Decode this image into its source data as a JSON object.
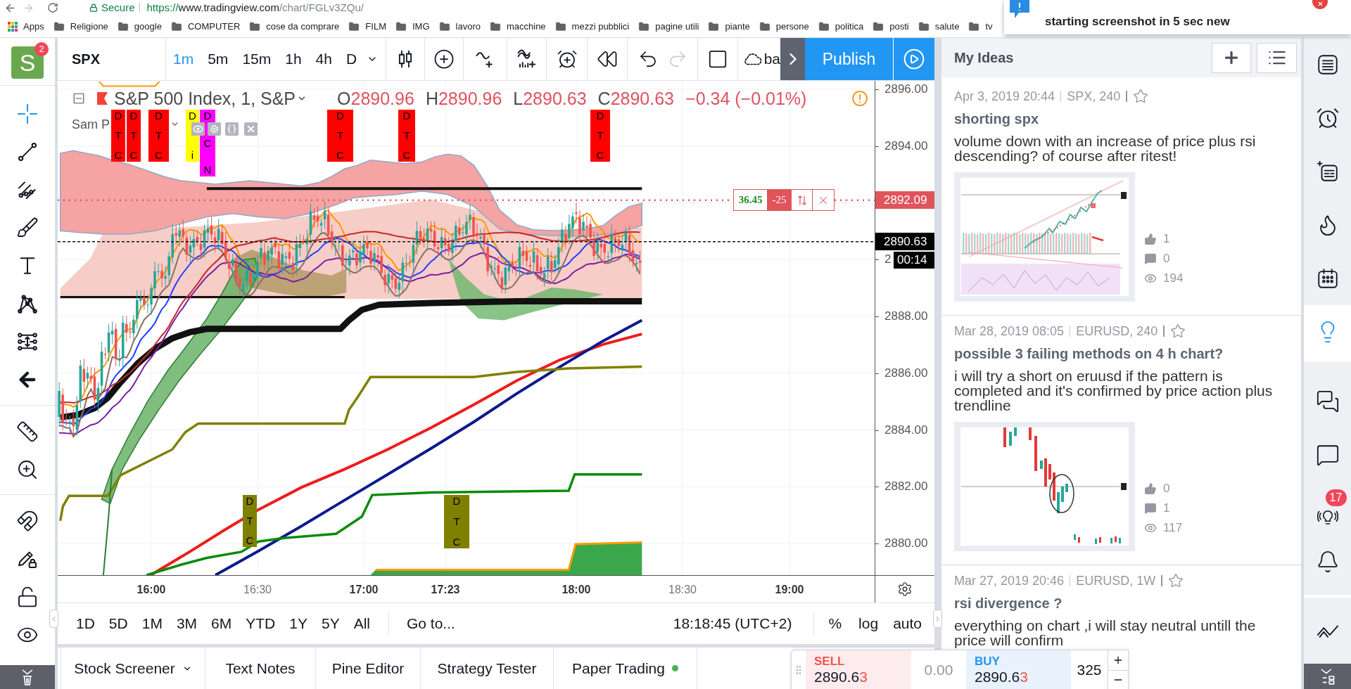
{
  "browser": {
    "forward_disabled": true,
    "secure_label": "Secure",
    "url": {
      "scheme": "https://",
      "host": "www.tradingview.com",
      "path": "/chart/FGLv3ZQu/"
    },
    "bookmarks": [
      {
        "kind": "apps",
        "label": "Apps"
      },
      {
        "kind": "folder",
        "label": "Religione"
      },
      {
        "kind": "folder",
        "label": "google"
      },
      {
        "kind": "folder",
        "label": "COMPUTER"
      },
      {
        "kind": "folder",
        "label": "cose da comprare"
      },
      {
        "kind": "folder",
        "label": "FILM"
      },
      {
        "kind": "folder",
        "label": "IMG"
      },
      {
        "kind": "folder",
        "label": "lavoro"
      },
      {
        "kind": "folder",
        "label": "macchine"
      },
      {
        "kind": "folder",
        "label": "mezzi pubblici"
      },
      {
        "kind": "folder",
        "label": "pagine utili"
      },
      {
        "kind": "folder",
        "label": "piante"
      },
      {
        "kind": "folder",
        "label": "persone"
      },
      {
        "kind": "folder",
        "label": "politica"
      },
      {
        "kind": "folder",
        "label": "posti"
      },
      {
        "kind": "folder",
        "label": "salute"
      },
      {
        "kind": "folder",
        "label": "tv"
      }
    ]
  },
  "notification": {
    "text": "starting screenshot in 5 sec new"
  },
  "account": {
    "initial": "S",
    "badge": "2"
  },
  "drawing_toolbar": {
    "groups": [
      {
        "tools": [
          {
            "kind": "crosshair",
            "selected": true
          },
          {
            "kind": "trend_line",
            "selected": false
          },
          {
            "kind": "pitchfork",
            "selected": false
          },
          {
            "kind": "brush",
            "selected": false
          },
          {
            "kind": "text",
            "selected": false
          },
          {
            "kind": "pattern",
            "selected": false
          },
          {
            "kind": "prediction",
            "selected": false
          },
          {
            "kind": "back",
            "selected": false
          }
        ]
      },
      {
        "tools": [
          {
            "kind": "ruler",
            "selected": false
          },
          {
            "kind": "zoom",
            "selected": false
          }
        ]
      },
      {
        "tools": [
          {
            "kind": "magnet",
            "selected": false
          },
          {
            "kind": "lock_drawings",
            "selected": false
          },
          {
            "kind": "lock",
            "selected": false
          },
          {
            "kind": "visibility",
            "selected": false
          }
        ]
      }
    ]
  },
  "top_toolbar": {
    "symbol": "SPX",
    "intervals": [
      {
        "label": "1m",
        "selected": true
      },
      {
        "label": "5m",
        "selected": false
      },
      {
        "label": "15m",
        "selected": false
      },
      {
        "label": "1h",
        "selected": false
      },
      {
        "label": "4h",
        "selected": false
      },
      {
        "label": "D",
        "selected": false
      }
    ],
    "redo_disabled": true,
    "save_label": "ba",
    "publish_label": "Publish"
  },
  "legend": {
    "title": "S&P 500 Index, 1, S&P",
    "ohlc": [
      {
        "key": "O",
        "value": "2890.96"
      },
      {
        "key": "H",
        "value": "2890.96"
      },
      {
        "key": "L",
        "value": "2890.63"
      },
      {
        "key": "C",
        "value": "2890.63"
      }
    ],
    "change": "−0.34 (−0.01%)",
    "indicator": "Sam P"
  },
  "chart": {
    "markers": [
      {
        "letters": [
          "D",
          "T",
          "C"
        ],
        "color": "#ff0000"
      },
      {
        "letters": [
          "D",
          "T",
          "C"
        ],
        "color": "#ff0000"
      },
      {
        "letters": [
          "D",
          "T",
          "C"
        ],
        "color": "#ff0000"
      },
      {
        "letters": [
          "D",
          "i"
        ],
        "color": "#ffff00"
      },
      {
        "letters": [
          "D",
          "C",
          "N"
        ],
        "color": "#ff00ff"
      },
      {
        "letters": [
          "D",
          "T",
          "C"
        ],
        "color": "#ff0000"
      },
      {
        "letters": [
          "D",
          "T",
          "C"
        ],
        "color": "#ff0000"
      },
      {
        "letters": [
          "D",
          "T",
          "C"
        ],
        "color": "#ff0000"
      },
      {
        "letters": [
          "D",
          "T",
          "C"
        ],
        "color": "#808000"
      },
      {
        "letters": [
          "D",
          "T",
          "C"
        ],
        "color": "#808000"
      }
    ],
    "position": {
      "profit": "36.45",
      "quantity": "-25"
    },
    "price_ticks": [
      "2896.00",
      "2894.00",
      "2",
      "2888.00",
      "2886.00",
      "2884.00",
      "2882.00",
      "2880.00"
    ],
    "price_tags": [
      {
        "text": "2892.09",
        "color": "#e0545c"
      },
      {
        "text": "2890.63",
        "color": "#000000"
      },
      {
        "text": "00:14",
        "color": "#000000"
      }
    ],
    "time_ticks": [
      {
        "label": "16:00",
        "major": true
      },
      {
        "label": "16:30",
        "major": false
      },
      {
        "label": "17:00",
        "major": true
      },
      {
        "label": "17:23",
        "major": true
      },
      {
        "label": "18:00",
        "major": true
      },
      {
        "label": "18:30",
        "major": false
      },
      {
        "label": "19:00",
        "major": true
      }
    ]
  },
  "range_bar": {
    "presets": [
      "1D",
      "5D",
      "1M",
      "3M",
      "6M",
      "YTD",
      "1Y",
      "5Y",
      "All"
    ],
    "goto": "Go to...",
    "clock": "18:18:45 (UTC+2)",
    "scale_options": [
      "%",
      "log",
      "auto"
    ]
  },
  "bottom_tabs": [
    {
      "label": "Stock Screener",
      "selected": false,
      "dropdown": true,
      "online": false
    },
    {
      "label": "Text Notes",
      "selected": false,
      "dropdown": false,
      "online": false
    },
    {
      "label": "Pine Editor",
      "selected": false,
      "dropdown": false,
      "online": false
    },
    {
      "label": "Strategy Tester",
      "selected": false,
      "dropdown": false,
      "online": false
    },
    {
      "label": "Paper Trading",
      "selected": false,
      "dropdown": false,
      "online": true
    }
  ],
  "trade": {
    "sell": {
      "label": "SELL",
      "price": "2890.6",
      "price_last": "3"
    },
    "spread": "0.00",
    "buy": {
      "label": "BUY",
      "price": "2890.6",
      "price_last": "3"
    },
    "quantity": "325"
  },
  "ideas_panel": {
    "title": "My Ideas",
    "ideas": [
      {
        "date": "Apr 3, 2019 20:44",
        "symbol": "SPX, 240",
        "starred": false,
        "title": "shorting spx",
        "description": "volume down with an increase of price plus rsi descending? of course after ritest!",
        "thumbnail": {
          "kind": "rising"
        },
        "likes": "1",
        "comments": "0",
        "views": "194"
      },
      {
        "date": "Mar 28, 2019 08:05",
        "symbol": "EURUSD, 240",
        "starred": false,
        "title": "possible 3 failing methods on 4 h chart?",
        "description": "i will try a short on eruusd if the pattern is completed and it's confirmed by price action plus trendline",
        "thumbnail": {
          "kind": "falling"
        },
        "likes": "0",
        "comments": "1",
        "views": "117"
      },
      {
        "date": "Mar 27, 2019 20:46",
        "symbol": "EURUSD, 1W",
        "starred": false,
        "title": "rsi divergence ?",
        "description": "everything on chart ,i will stay neutral untill the price will confirm"
      }
    ]
  },
  "right_sidebar": {
    "groups": [
      {
        "items": [
          {
            "kind": "watchlist",
            "selected": false
          },
          {
            "kind": "alerts",
            "selected": false
          },
          {
            "kind": "data_window",
            "selected": false
          },
          {
            "kind": "hotlist",
            "selected": false
          },
          {
            "kind": "calendar",
            "selected": false
          },
          {
            "kind": "ideas",
            "selected": true
          }
        ]
      },
      {
        "items": [
          {
            "kind": "chats",
            "selected": false
          },
          {
            "kind": "private_chat",
            "selected": false
          },
          {
            "kind": "idea_stream",
            "selected": false,
            "badge": "17"
          },
          {
            "kind": "notifications",
            "selected": false
          }
        ]
      },
      {
        "items": [
          {
            "kind": "trading",
            "selected": false
          }
        ]
      }
    ]
  }
}
